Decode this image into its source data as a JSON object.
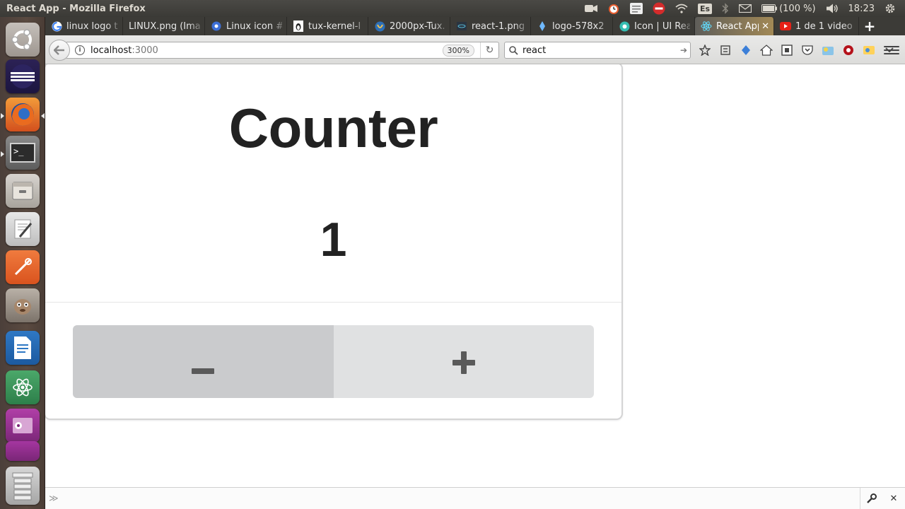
{
  "window": {
    "title": "React App - Mozilla Firefox"
  },
  "system_tray": {
    "keyboard_layout": "Es",
    "battery": "(100 %)",
    "clock": "18:23"
  },
  "launcher": {
    "apps": [
      "ubuntu-dash-icon",
      "eclipse-icon",
      "firefox-icon",
      "terminal-icon",
      "files-icon",
      "text-editor-icon",
      "gitkraken-icon",
      "gimp-icon",
      "libreoffice-writer-icon",
      "atom-icon",
      "workspace-switcher-icon",
      "workspace-icon",
      "trash-icon"
    ]
  },
  "tabs": [
    {
      "label": "linux logo t",
      "icon": "google-icon"
    },
    {
      "label": "LINUX.png (Ima",
      "icon": ""
    },
    {
      "label": "Linux icon #",
      "icon": "site-icon"
    },
    {
      "label": "tux-kernel-l",
      "icon": "image-icon"
    },
    {
      "label": "2000px-Tux.",
      "icon": "wiki-icon"
    },
    {
      "label": "react-1.png",
      "icon": "image-icon"
    },
    {
      "label": "logo-578x2",
      "icon": "site-icon"
    },
    {
      "label": "Icon | UI Rea",
      "icon": "semantic-icon"
    },
    {
      "label": "React App",
      "icon": "react-icon",
      "active": true
    },
    {
      "label": "1 de 1 video",
      "icon": "youtube-icon"
    }
  ],
  "navbar": {
    "url_host": "localhost",
    "url_port": ":3000",
    "zoom": "300%",
    "search_value": "react"
  },
  "app": {
    "title": "Counter",
    "count": "1",
    "decrement_label": "−",
    "increment_label": "+"
  },
  "colors": {
    "minus_bg": "#cacbcd",
    "plus_bg": "#e0e1e2",
    "text": "#222222"
  }
}
